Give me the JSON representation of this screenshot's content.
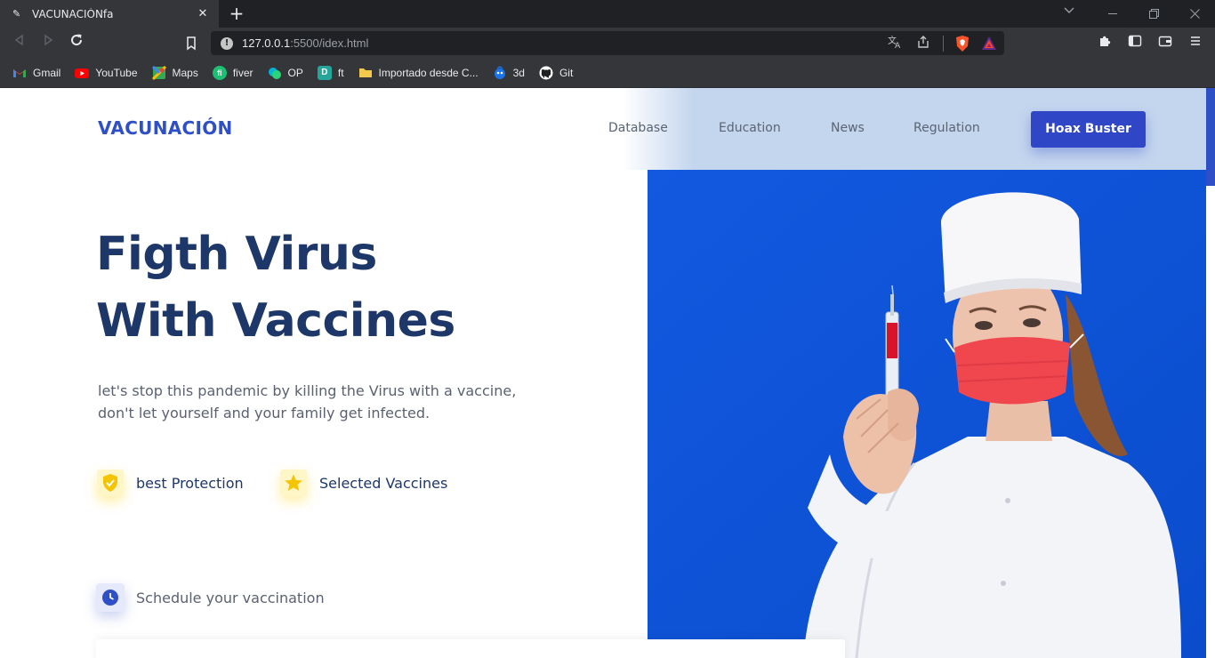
{
  "browser": {
    "tab": {
      "title": "VACUNACIÓNfa"
    },
    "url": {
      "host": "127.0.0.1",
      "path": ":5500/idex.html"
    },
    "bookmarks": [
      {
        "label": "Gmail",
        "icon": "gmail-icon",
        "color": "#ea4335",
        "glyph": "M"
      },
      {
        "label": "YouTube",
        "icon": "youtube-icon",
        "color": "#ff0000",
        "glyph": "▶"
      },
      {
        "label": "Maps",
        "icon": "maps-icon",
        "color": "#34a853",
        "glyph": "◆"
      },
      {
        "label": "fiver",
        "icon": "fiverr-icon",
        "color": "#1dbf73",
        "glyph": "fi"
      },
      {
        "label": "OP",
        "icon": "op-icon",
        "color": "#00b4d8",
        "glyph": "●"
      },
      {
        "label": "ft",
        "icon": "ft-icon",
        "color": "#26a69a",
        "glyph": "D"
      },
      {
        "label": "Importado desde C...",
        "icon": "folder-icon",
        "color": "#f2c94c",
        "glyph": ""
      },
      {
        "label": "3d",
        "icon": "3d-icon",
        "color": "#1a73e8",
        "glyph": "◉"
      },
      {
        "label": "Git",
        "icon": "github-icon",
        "color": "#ffffff",
        "glyph": "●"
      }
    ]
  },
  "page": {
    "brand": "VACUNACIÓN",
    "nav": {
      "database": "Database",
      "education": "Education",
      "news": "News",
      "regulation": "Regulation",
      "cta": "Hoax Buster"
    },
    "hero": {
      "line1": "Figth Virus",
      "line2": "With Vaccines",
      "subtext": "let's stop this pandemic by killing the Virus with a vaccine, don't let yourself and your family get infected."
    },
    "features": {
      "protection": "best Protection",
      "vaccines": "Selected Vaccines"
    },
    "schedule": {
      "label": "Schedule your vaccination"
    },
    "colors": {
      "brand": "#2f4fc7",
      "heading": "#1e3769",
      "hero_bg": "#0f56d8",
      "accent_yellow": "#ffd000"
    }
  }
}
